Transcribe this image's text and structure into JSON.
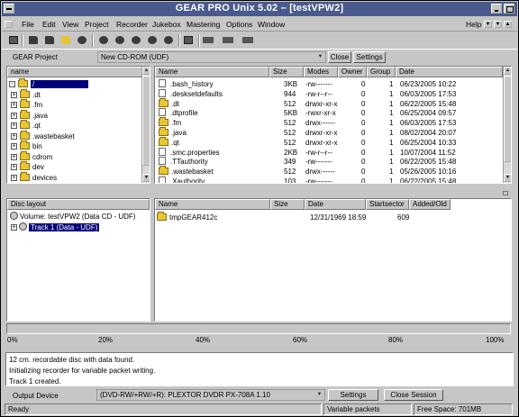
{
  "window": {
    "title": "GEAR PRO Unix 5.02 – [testVPW2]"
  },
  "menu": {
    "items": [
      "File",
      "Edit",
      "View",
      "Project",
      "Recorder",
      "Jukebox",
      "Mastering",
      "Options",
      "Window"
    ],
    "help": "Help",
    "right_buttons": [
      "▼",
      "▼",
      "▲"
    ]
  },
  "toolbar": {
    "icons": [
      "fold-gear-icon",
      "open-folder-icon",
      "open-folder-2-icon",
      "open-folder-yellow-icon",
      "save-icon",
      "disc-1-icon",
      "disc-2-icon",
      "disc-3-icon",
      "disc-4-icon",
      "disc-5-icon",
      "stop-icon",
      "eject-icon",
      "settings-icon",
      "info-icon"
    ]
  },
  "project_bar": {
    "label": "GEAR Project",
    "combo_value": "New CD-ROM (UDF)",
    "close_label": "Close",
    "settings_label": "Settings"
  },
  "tree": {
    "header": "name",
    "items": [
      {
        "label": "/",
        "level": 0,
        "selected": true,
        "expander": "-"
      },
      {
        "label": ".dt",
        "level": 1,
        "expander": "+"
      },
      {
        "label": ".fm",
        "level": 1,
        "expander": "+"
      },
      {
        "label": ".java",
        "level": 1,
        "expander": "+"
      },
      {
        "label": ".qt",
        "level": 1,
        "expander": "+"
      },
      {
        "label": ".wastebasket",
        "level": 1,
        "expander": "+"
      },
      {
        "label": "bin",
        "level": 1,
        "expander": "+"
      },
      {
        "label": "cdrom",
        "level": 1,
        "expander": "+"
      },
      {
        "label": "dev",
        "level": 1,
        "expander": "+"
      },
      {
        "label": "devices",
        "level": 1,
        "expander": "+"
      }
    ]
  },
  "files": {
    "headers": [
      "Name",
      "Size",
      "Modes",
      "Owner",
      "Group",
      "Date"
    ],
    "rows": [
      {
        "type": "doc",
        "name": ".bash_history",
        "size": "3KB",
        "modes": "-rw-------",
        "owner": "0",
        "group": "1",
        "date": "06/23/2005 10:22"
      },
      {
        "type": "doc",
        "name": ".desksetdefaults",
        "size": "944",
        "modes": "-rw-r--r--",
        "owner": "0",
        "group": "1",
        "date": "06/03/2005 17:53"
      },
      {
        "type": "folder",
        "name": ".dt",
        "size": "512",
        "modes": "drwxr-xr-x",
        "owner": "0",
        "group": "1",
        "date": "06/22/2005 15:48"
      },
      {
        "type": "doc",
        "name": ".dtprofile",
        "size": "5KB",
        "modes": "-rwxr-xr-x",
        "owner": "0",
        "group": "1",
        "date": "06/25/2004 09:57"
      },
      {
        "type": "folder",
        "name": ".fm",
        "size": "512",
        "modes": "drwx------",
        "owner": "0",
        "group": "1",
        "date": "06/03/2005 17:53"
      },
      {
        "type": "folder",
        "name": ".java",
        "size": "512",
        "modes": "drwxr-xr-x",
        "owner": "0",
        "group": "1",
        "date": "08/02/2004 20:07"
      },
      {
        "type": "folder",
        "name": ".qt",
        "size": "512",
        "modes": "drwxr-xr-x",
        "owner": "0",
        "group": "1",
        "date": "06/25/2004 10:33"
      },
      {
        "type": "doc",
        "name": ".smc.properties",
        "size": "2KB",
        "modes": "-rw-r--r--",
        "owner": "0",
        "group": "1",
        "date": "10/07/2004 11:52"
      },
      {
        "type": "doc",
        "name": ".TTauthority",
        "size": "349",
        "modes": "-rw-------",
        "owner": "0",
        "group": "1",
        "date": "06/22/2005 15:48"
      },
      {
        "type": "folder",
        "name": ".wastebasket",
        "size": "512",
        "modes": "drwx------",
        "owner": "0",
        "group": "1",
        "date": "05/26/2005 10:16"
      },
      {
        "type": "doc",
        "name": ".Xauthority",
        "size": "103",
        "modes": "-rw-------",
        "owner": "0",
        "group": "1",
        "date": "06/22/2005 15:48"
      }
    ]
  },
  "disc_layout": {
    "header": "Disc layout",
    "volume": "Volume: testVPW2 (Data CD - UDF)",
    "track": "Track 1 (Data - UDF)"
  },
  "disc_files": {
    "headers": [
      "Name",
      "Size",
      "Date",
      "Startsector",
      "Added/Old"
    ],
    "rows": [
      {
        "name": "tmpGEAR412c",
        "size": "",
        "date": "12/31/1969 18:59",
        "startsector": "609",
        "added": ""
      }
    ]
  },
  "progress": {
    "fill_fraction": 0,
    "ticks": [
      "0%",
      "20%",
      "40%",
      "60%",
      "80%",
      "100%"
    ]
  },
  "log": {
    "lines": [
      "12 cm. recordable disc with data found.",
      "Initializing recorder for variable packet writing.",
      "Track 1 created."
    ]
  },
  "output": {
    "label": "Output Device",
    "combo_value": "(DVD-RW/+RW/+R):  PLEXTOR DVDR   PX-708A 1.10",
    "settings_label": "Settings",
    "close_session_label": "Close Session"
  },
  "status": {
    "left": "Ready",
    "mid": "Variable packets",
    "right": "Free Space: 701MB"
  }
}
